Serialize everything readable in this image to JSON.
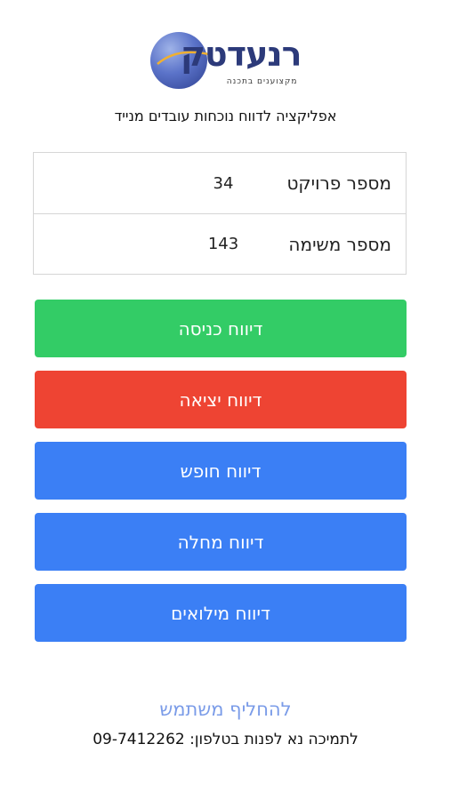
{
  "logo": {
    "brand_text": "רנעדטק",
    "tagline": "מקצוענים בתכנה"
  },
  "subtitle": "אפליקציה לדווח נוכחות עובדים מנייד",
  "info": {
    "project": {
      "label": "מספר פרויקט",
      "value": "34"
    },
    "task": {
      "label": "מספר משימה",
      "value": "143"
    }
  },
  "buttons": {
    "checkin": "דיווח כניסה",
    "checkout": "דיווח יציאה",
    "vacation": "דיווח חופש",
    "sick": "דיווח מחלה",
    "reserve": "דיווח מילואים"
  },
  "switch_user": "להחליף משתמש",
  "support": "לתמיכה נא לפנות בטלפון: 09-7412262",
  "colors": {
    "green": "#33cc66",
    "red": "#ee4433",
    "blue": "#3b7ff5",
    "link": "#7b9ce8"
  }
}
